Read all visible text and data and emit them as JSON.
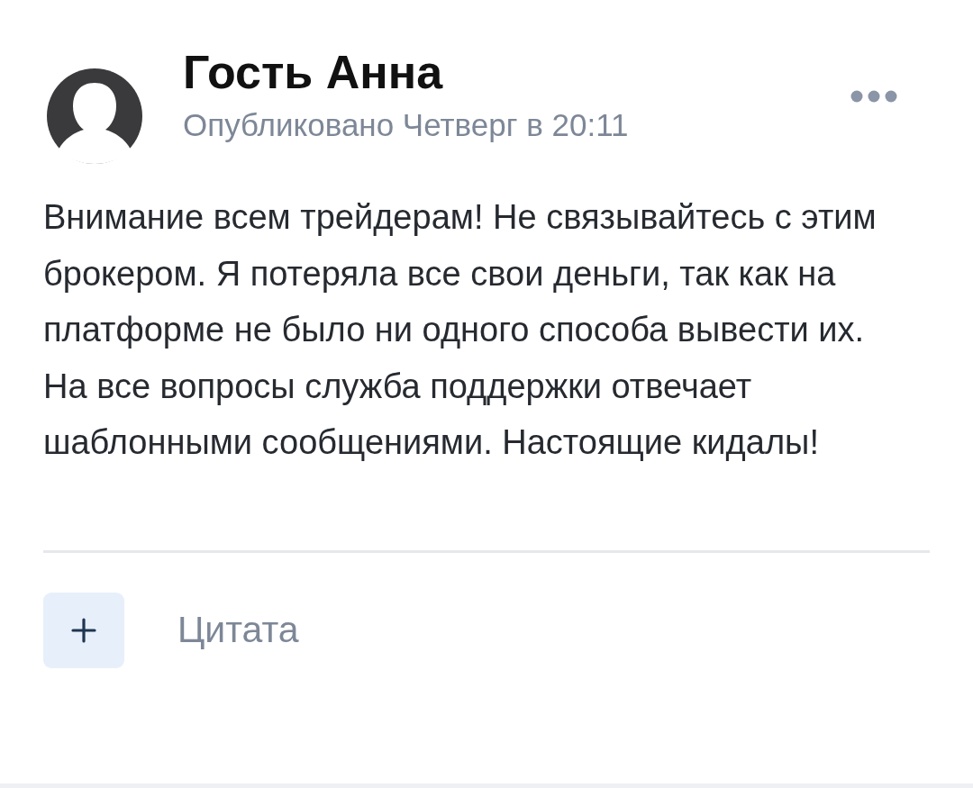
{
  "post": {
    "author": "Гость Анна",
    "published": "Опубликовано Четверг в 20:11",
    "text": "Внимание всем трейдерам! Не связывайтесь с этим брокером. Я потеряла все свои деньги, так как на платформе не было ни одного способа вывести их. На все вопросы служба поддержки отвечает шаблонными сообщениями. Настоящие кидалы!"
  },
  "actions": [
    {
      "kind": "plus",
      "label": "Цитата"
    }
  ]
}
